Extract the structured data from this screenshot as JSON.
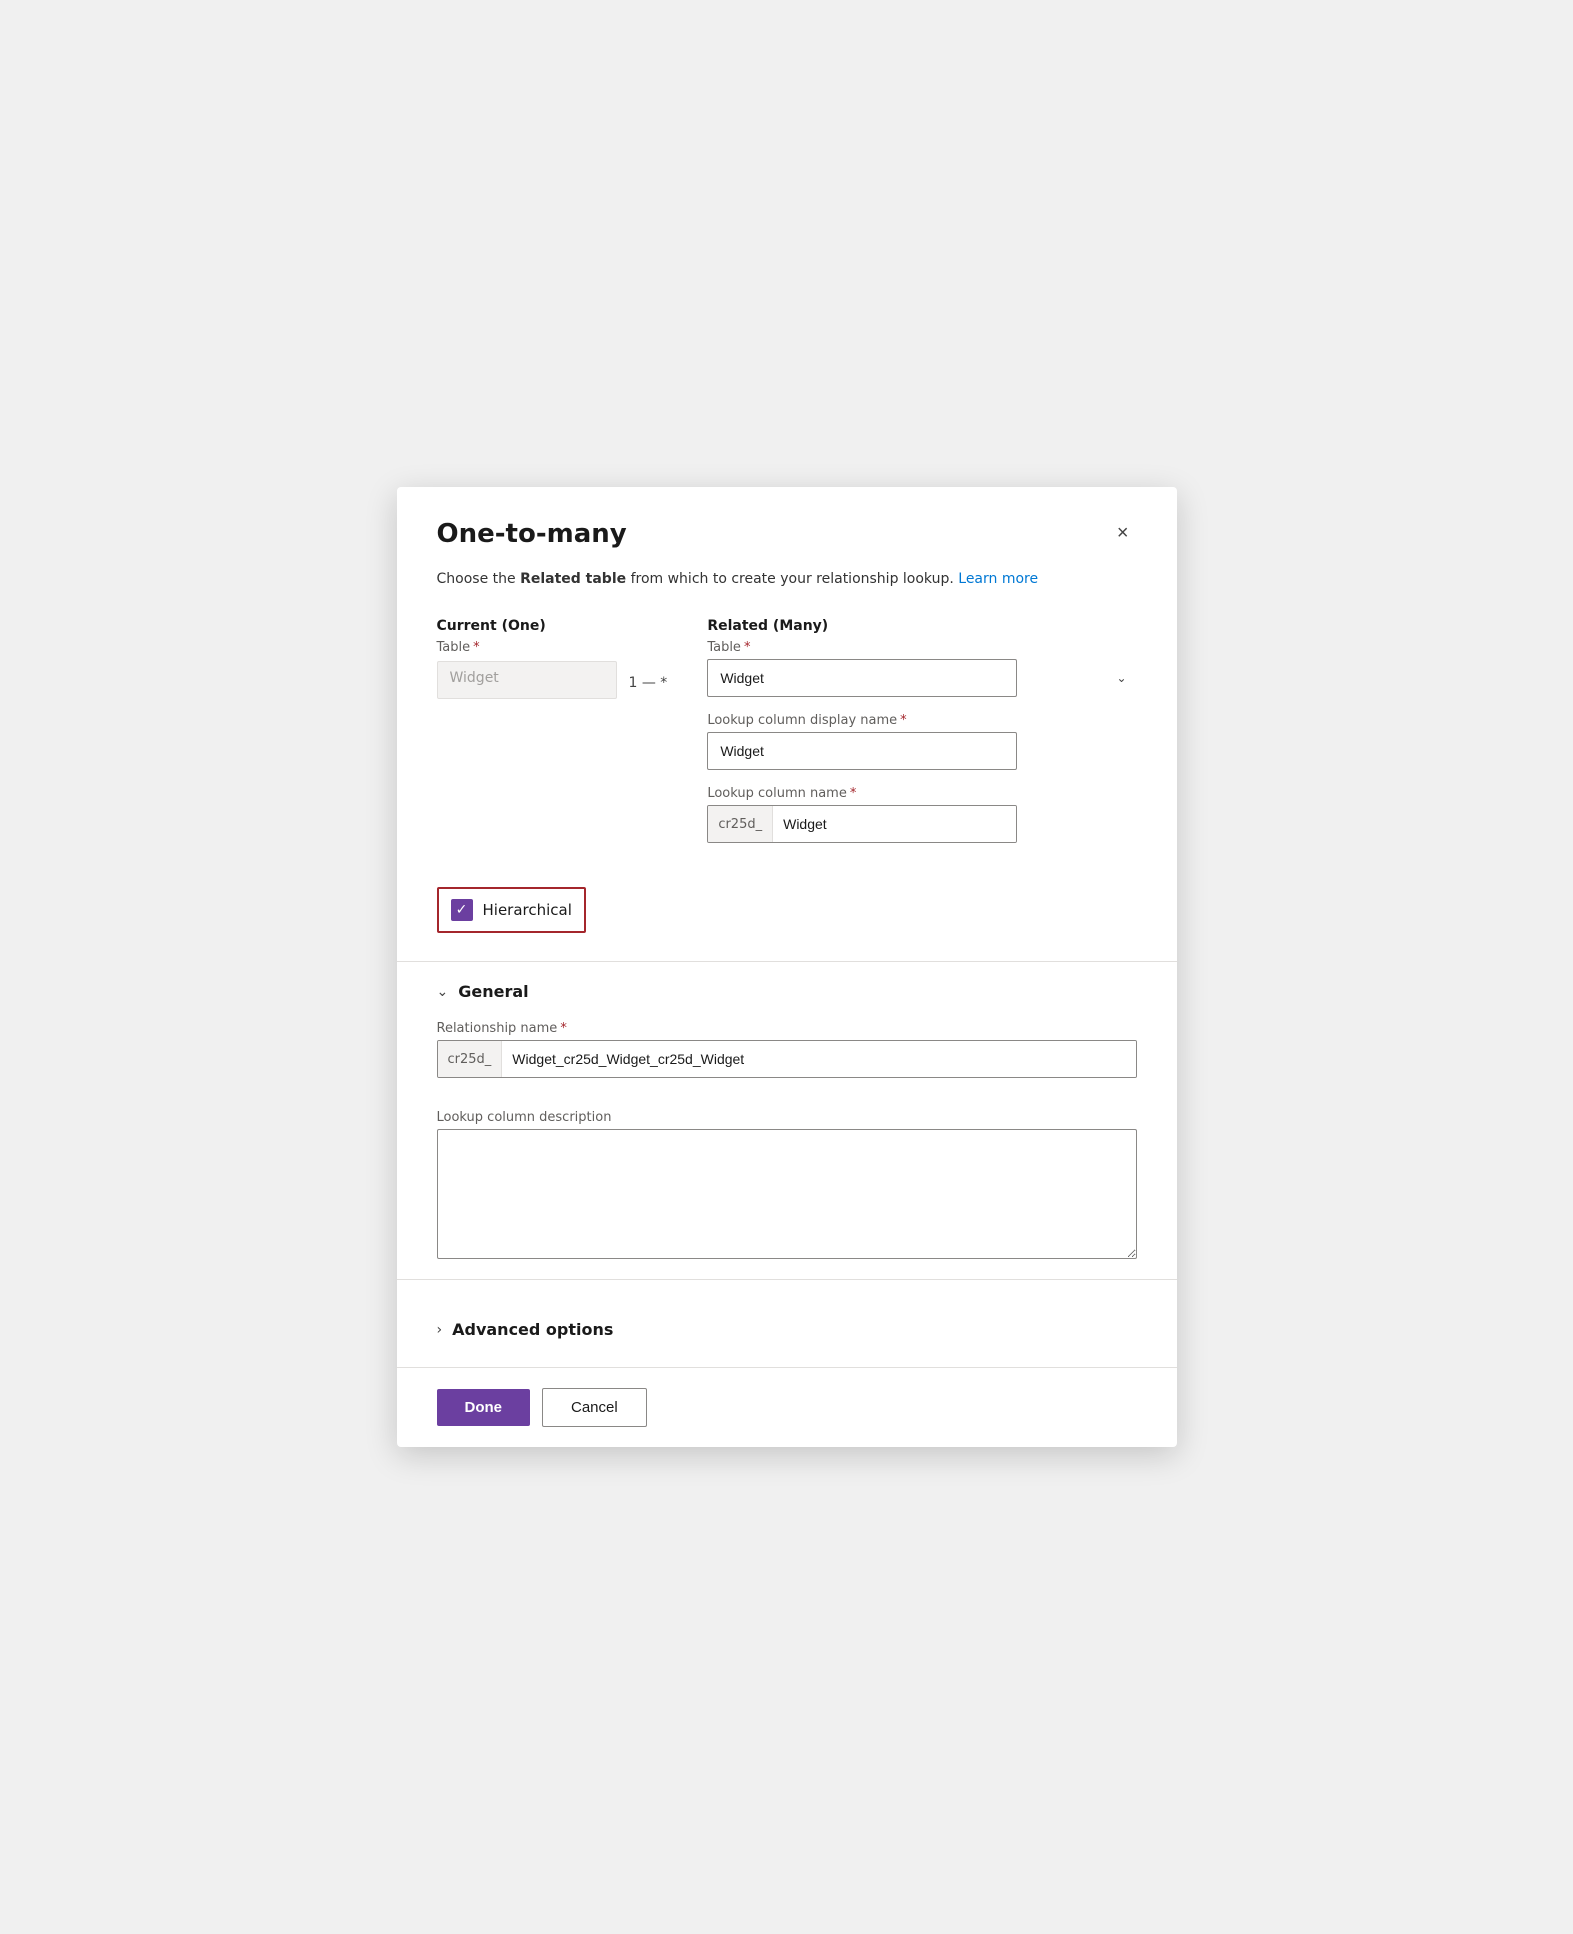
{
  "dialog": {
    "title": "One-to-many",
    "close_label": "×"
  },
  "description": {
    "text_before": "Choose the ",
    "bold_text": "Related table",
    "text_after": " from which to create your relationship lookup.",
    "learn_more": "Learn more"
  },
  "current_section": {
    "header": "Current (One)",
    "table_label": "Table",
    "table_value": "Widget"
  },
  "relation_symbol": "1 — *",
  "related_section": {
    "header": "Related (Many)",
    "table_label": "Table",
    "table_value": "Widget",
    "lookup_display_label": "Lookup column display name",
    "lookup_display_required": "*",
    "lookup_display_value": "Widget",
    "lookup_name_label": "Lookup column name",
    "lookup_name_required": "*",
    "lookup_name_prefix": "cr25d_",
    "lookup_name_value": "Widget"
  },
  "hierarchical": {
    "label": "Hierarchical",
    "checked": true
  },
  "general_section": {
    "label": "General",
    "expanded": true
  },
  "relationship_name": {
    "label": "Relationship name",
    "required": "*",
    "prefix": "cr25d_",
    "value": "Widget_cr25d_Widget_cr25d_Widget"
  },
  "lookup_description": {
    "label": "Lookup column description",
    "value": ""
  },
  "advanced_options": {
    "label": "Advanced options",
    "expanded": false
  },
  "footer": {
    "done_label": "Done",
    "cancel_label": "Cancel"
  }
}
